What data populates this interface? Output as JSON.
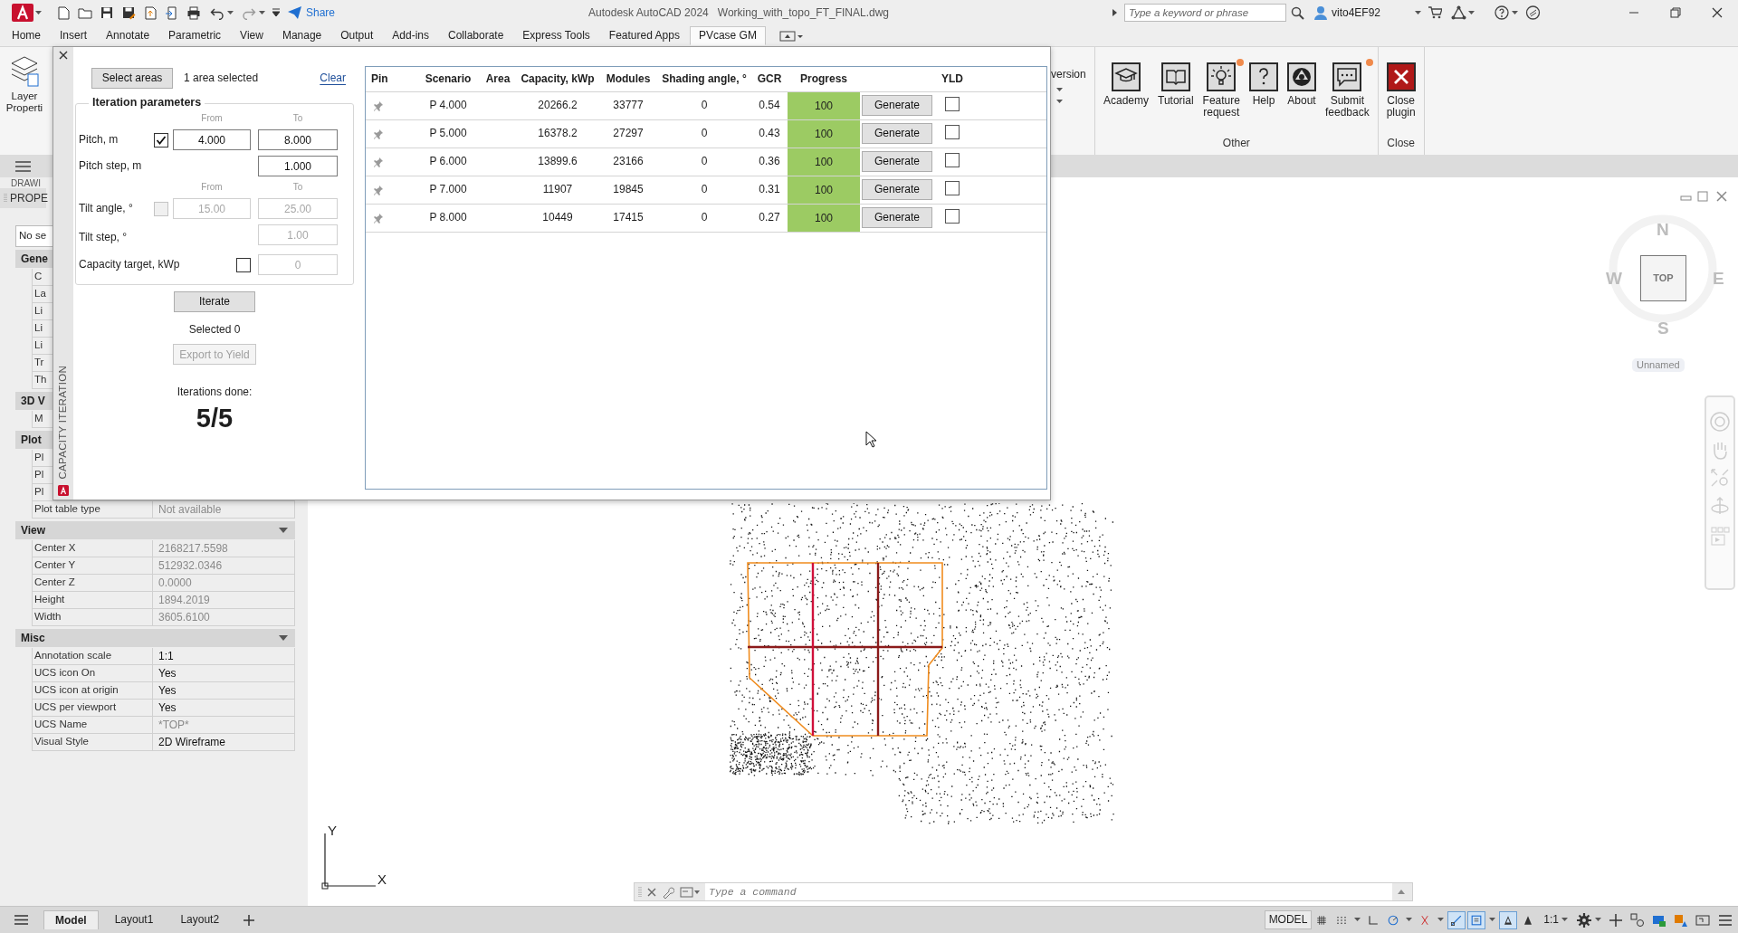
{
  "title_bar": {
    "share": "Share",
    "app_title": "Autodesk AutoCAD 2024",
    "file_name": "Working_with_topo_FT_FINAL.dwg",
    "search": {
      "placeholder": "Type a keyword or phrase"
    },
    "user": "vito4EF92"
  },
  "ribbon_tabs": [
    {
      "label": "Home",
      "selected": false
    },
    {
      "label": "Insert",
      "selected": false
    },
    {
      "label": "Annotate",
      "selected": false
    },
    {
      "label": "Parametric",
      "selected": false
    },
    {
      "label": "View",
      "selected": false
    },
    {
      "label": "Manage",
      "selected": false
    },
    {
      "label": "Output",
      "selected": false
    },
    {
      "label": "Add-ins",
      "selected": false
    },
    {
      "label": "Collaborate",
      "selected": false
    },
    {
      "label": "Express Tools",
      "selected": false
    },
    {
      "label": "Featured Apps",
      "selected": false
    },
    {
      "label": "PVcase GM",
      "selected": true
    }
  ],
  "ribbon": {
    "layer_button": {
      "line_1": "Layer",
      "line_2": "Properti"
    },
    "partial_label": "version",
    "groups": [
      {
        "title": "Other",
        "buttons": [
          {
            "label": "Academy",
            "kind": "cap",
            "notification": false
          },
          {
            "label": "Tutorial",
            "kind": "book",
            "notification": false
          },
          {
            "label": "Feature request",
            "kind": "bulb",
            "notification": true
          },
          {
            "label": "Help",
            "kind": "question",
            "notification": false
          },
          {
            "label": "About",
            "kind": "logo",
            "notification": false
          },
          {
            "label": "Submit feedback",
            "kind": "chat",
            "notification": true
          }
        ]
      },
      {
        "title": "Close",
        "buttons": [
          {
            "label": "Close plugin",
            "kind": "close",
            "notification": false
          }
        ]
      }
    ]
  },
  "dialog": {
    "side_title": "CAPACITY ITERATION",
    "select_button": "Select areas",
    "selection_status": "1 area selected",
    "clear_link": "Clear",
    "parameters": {
      "title": "Iteration parameters",
      "pitch": {
        "from_label": "From",
        "to_label": "To",
        "label": "Pitch, m",
        "checked": true,
        "from": "4.000",
        "to": "8.000"
      },
      "pitch_step": {
        "label": "Pitch step, m",
        "value": "1.000"
      },
      "tilt": {
        "from_label": "From",
        "to_label": "To",
        "label": "Tilt angle, °",
        "checked": false,
        "from": "15.00",
        "to": "25.00"
      },
      "tilt_step": {
        "label": "Tilt step, °",
        "value": "1.00"
      },
      "capacity_target": {
        "label": "Capacity target, kWp",
        "checked": false,
        "value": "0"
      }
    },
    "iterate_button": "Iterate",
    "selected_count": "Selected 0",
    "export_button": {
      "label": "Export to Yield",
      "disabled": true
    },
    "iterations_label": "Iterations done:",
    "iterations_value": "5/5",
    "table": {
      "columns": [
        "Pin",
        "Scenario",
        "Area",
        "Capacity, kWp",
        "Modules",
        "Shading angle, °",
        "GCR",
        "Progress",
        "YLD"
      ],
      "rows": [
        {
          "pinned": false,
          "scenario": "P 4.000",
          "capacity": "20266.2",
          "modules": "33777",
          "shading": "0",
          "gcr": "0.54",
          "progress": "100",
          "level": 1,
          "button": "Generate",
          "yld": false
        },
        {
          "pinned": false,
          "scenario": "P 5.000",
          "capacity": "16378.2",
          "modules": "27297",
          "shading": "0",
          "gcr": "0.43",
          "progress": "100",
          "level": 1,
          "button": "Generate",
          "yld": false
        },
        {
          "pinned": false,
          "scenario": "P 6.000",
          "capacity": "13899.6",
          "modules": "23166",
          "shading": "0",
          "gcr": "0.36",
          "progress": "100",
          "level": 1,
          "button": "Generate",
          "yld": false
        },
        {
          "pinned": false,
          "scenario": "P 7.000",
          "capacity": "11907",
          "modules": "19845",
          "shading": "0",
          "gcr": "0.31",
          "progress": "100",
          "level": 1,
          "button": "Generate",
          "yld": false
        },
        {
          "pinned": false,
          "scenario": "P 8.000",
          "capacity": "10449",
          "modules": "17415",
          "shading": "0",
          "gcr": "0.27",
          "progress": "100",
          "level": 1,
          "button": "Generate",
          "yld": false
        }
      ]
    }
  },
  "palette": {
    "collapsed_title": "DRAWI",
    "title": "PROPE",
    "selection": "No se",
    "sections": [
      {
        "title": "Gene",
        "expanded": true,
        "rows": [
          {
            "label": "C"
          },
          {
            "label": "La"
          },
          {
            "label": "Li"
          },
          {
            "label": "Li"
          },
          {
            "label": "Li"
          },
          {
            "label": "Tr"
          },
          {
            "label": "Th"
          }
        ]
      },
      {
        "title": "3D V",
        "expanded": true,
        "rows": [
          {
            "label": "M"
          }
        ]
      },
      {
        "title": "Plot",
        "expanded": true,
        "rows": [
          {
            "label": "Pl"
          },
          {
            "label": "Pl"
          },
          {
            "label": "Pl"
          },
          {
            "label": "Plot table type",
            "value": "Not available",
            "editable": false
          }
        ]
      },
      {
        "title": "View",
        "expanded": true,
        "rows": [
          {
            "label": "Center X",
            "value": "2168217.5598",
            "editable": false
          },
          {
            "label": "Center Y",
            "value": "512932.0346",
            "editable": false
          },
          {
            "label": "Center Z",
            "value": "0.0000",
            "editable": false
          },
          {
            "label": "Height",
            "value": "1894.2019",
            "editable": false
          },
          {
            "label": "Width",
            "value": "3605.6100",
            "editable": false
          }
        ]
      },
      {
        "title": "Misc",
        "expanded": true,
        "rows": [
          {
            "label": "Annotation scale",
            "value": "1:1",
            "editable": true
          },
          {
            "label": "UCS icon On",
            "value": "Yes",
            "editable": true
          },
          {
            "label": "UCS icon at origin",
            "value": "Yes",
            "editable": true
          },
          {
            "label": "UCS per viewport",
            "value": "Yes",
            "editable": true
          },
          {
            "label": "UCS Name",
            "value": "*TOP*",
            "editable": false
          },
          {
            "label": "Visual Style",
            "value": "2D Wireframe",
            "editable": true
          }
        ]
      }
    ]
  },
  "viewcube": {
    "north": "N",
    "west": "W",
    "east": "E",
    "south": "S",
    "face": "TOP",
    "view_name": "Unnamed"
  },
  "ucs": {
    "y": "Y",
    "x": "X"
  },
  "command_line": {
    "placeholder": "Type a command"
  },
  "status_bar": {
    "layout_tabs": [
      {
        "label": "Model",
        "selected": true
      },
      {
        "label": "Layout1",
        "selected": false
      },
      {
        "label": "Layout2",
        "selected": false
      }
    ],
    "model_button": "MODEL",
    "scale": "1:1",
    "toggles": [
      {
        "kind": "grid",
        "on": false
      },
      {
        "kind": "snap",
        "on": false
      },
      {
        "kind": "ortho",
        "on": false
      },
      {
        "kind": "polar",
        "on": false
      },
      {
        "kind": "isodraft",
        "on": false
      },
      {
        "kind": "osnap",
        "on": true
      },
      {
        "kind": "lineweight",
        "on": true
      },
      {
        "kind": "annovisible",
        "on": true
      },
      {
        "kind": "autoscale",
        "on": false
      }
    ],
    "tools": [
      {
        "kind": "gear"
      },
      {
        "kind": "plus"
      },
      {
        "kind": "isolate"
      },
      {
        "kind": "hardware"
      },
      {
        "kind": "units"
      },
      {
        "kind": "fullscreen"
      },
      {
        "kind": "menu"
      }
    ]
  }
}
